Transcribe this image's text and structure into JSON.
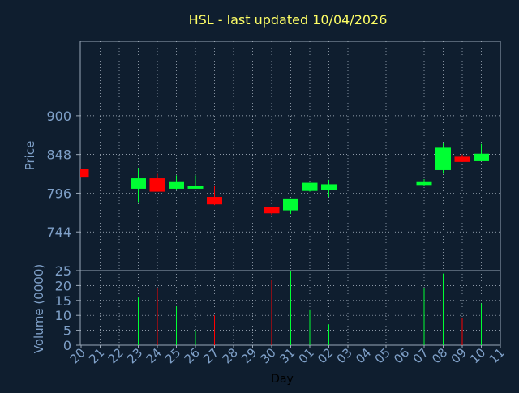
{
  "chart_data": {
    "type": "candlestick",
    "title": "HSL - last updated 10/04/2026",
    "xlabel": "Day",
    "days": [
      "20",
      "21",
      "22",
      "23",
      "24",
      "25",
      "26",
      "27",
      "28",
      "29",
      "30",
      "31",
      "01",
      "02",
      "03",
      "04",
      "05",
      "06",
      "07",
      "08",
      "09",
      "10",
      "11"
    ],
    "price_panel": {
      "ylabel": "Price",
      "ylim": [
        692,
        1000
      ],
      "yticks": [
        744,
        796,
        848,
        900
      ],
      "ytick_labels": [
        "744",
        "796",
        "848",
        "900"
      ],
      "grid": true
    },
    "volume_panel": {
      "ylabel": "Volume (0000)",
      "ylim": [
        0,
        25
      ],
      "yticks": [
        0,
        5,
        10,
        15,
        20,
        25
      ],
      "ytick_labels": [
        "0",
        "5",
        "10",
        "15",
        "20",
        "25"
      ],
      "grid": true
    },
    "candles": [
      {
        "day": "20",
        "open": 829,
        "high": 829,
        "low": 817,
        "close": 817,
        "direction": "down"
      },
      {
        "day": "23",
        "open": 802,
        "high": 830,
        "low": 784,
        "close": 816,
        "direction": "up"
      },
      {
        "day": "24",
        "open": 816,
        "high": 822,
        "low": 798,
        "close": 798,
        "direction": "down"
      },
      {
        "day": "25",
        "open": 802,
        "high": 820,
        "low": 800,
        "close": 812,
        "direction": "up"
      },
      {
        "day": "26",
        "open": 802,
        "high": 820,
        "low": 802,
        "close": 806,
        "direction": "up"
      },
      {
        "day": "27",
        "open": 791,
        "high": 806,
        "low": 780,
        "close": 781,
        "direction": "down"
      },
      {
        "day": "30",
        "open": 777,
        "high": 777,
        "low": 767,
        "close": 769,
        "direction": "down"
      },
      {
        "day": "31",
        "open": 773,
        "high": 789,
        "low": 768,
        "close": 789,
        "direction": "up"
      },
      {
        "day": "01",
        "open": 799,
        "high": 810,
        "low": 798,
        "close": 810,
        "direction": "up"
      },
      {
        "day": "02",
        "open": 800,
        "high": 814,
        "low": 791,
        "close": 808,
        "direction": "up"
      },
      {
        "day": "07",
        "open": 807,
        "high": 815,
        "low": 806,
        "close": 812,
        "direction": "up"
      },
      {
        "day": "08",
        "open": 827,
        "high": 863,
        "low": 822,
        "close": 857,
        "direction": "up"
      },
      {
        "day": "09",
        "open": 845,
        "high": 848,
        "low": 838,
        "close": 838,
        "direction": "down"
      },
      {
        "day": "10",
        "open": 839,
        "high": 862,
        "low": 839,
        "close": 849,
        "direction": "up"
      }
    ],
    "volume": [
      {
        "day": "23",
        "value": 16,
        "direction": "up"
      },
      {
        "day": "24",
        "value": 19,
        "direction": "down"
      },
      {
        "day": "25",
        "value": 13,
        "direction": "up"
      },
      {
        "day": "26",
        "value": 5,
        "direction": "up"
      },
      {
        "day": "27",
        "value": 10,
        "direction": "down"
      },
      {
        "day": "30",
        "value": 22,
        "direction": "down"
      },
      {
        "day": "31",
        "value": 25,
        "direction": "up"
      },
      {
        "day": "01",
        "value": 12,
        "direction": "up"
      },
      {
        "day": "02",
        "value": 7,
        "direction": "up"
      },
      {
        "day": "07",
        "value": 19,
        "direction": "up"
      },
      {
        "day": "08",
        "value": 24,
        "direction": "up"
      },
      {
        "day": "09",
        "value": 9,
        "direction": "down"
      },
      {
        "day": "10",
        "value": 14,
        "direction": "up"
      }
    ],
    "colors": {
      "background": "#0f1e2f",
      "plot_background": "#0f1e2f",
      "grid": "#b8c4d0",
      "axis": "#9aa8b8",
      "label": "#7fa0c8",
      "title": "#ffff66",
      "up": "#00ff33",
      "down": "#ff0000"
    }
  }
}
